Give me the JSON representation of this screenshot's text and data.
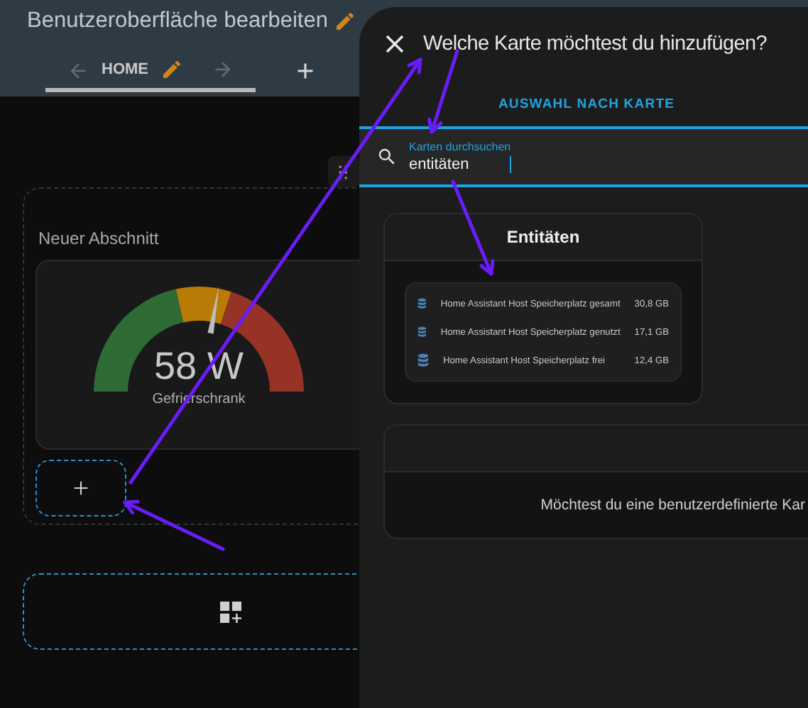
{
  "header": {
    "title": "Benutzeroberfläche bearbeiten"
  },
  "views": [
    {
      "label": "HOME",
      "selected": true
    }
  ],
  "section": {
    "title": "Neuer Abschnitt",
    "gauge": {
      "value": "58 W",
      "name": "Gefrierschrank",
      "level": 0.56
    }
  },
  "dialog": {
    "title": "Welche Karte möchtest du hinzufügen?",
    "tabs": [
      {
        "label": "AUSWAHL NACH KARTE",
        "selected": true
      }
    ],
    "search": {
      "label": "Karten durchsuchen",
      "value": "entitäten"
    },
    "entities_card": {
      "title": "Entitäten",
      "rows": [
        {
          "name": "Home Assistant Host Speicherplatz gesamt",
          "value": "30,8 GB"
        },
        {
          "name": "Home Assistant Host Speicherplatz genutzt",
          "value": "17,1 GB"
        },
        {
          "name": "Home Assistant Host Speicherplatz frei",
          "value": "12,4 GB"
        }
      ]
    },
    "custom_card": {
      "message": "Möchtest du eine benutzerdefinierte Kar"
    }
  }
}
